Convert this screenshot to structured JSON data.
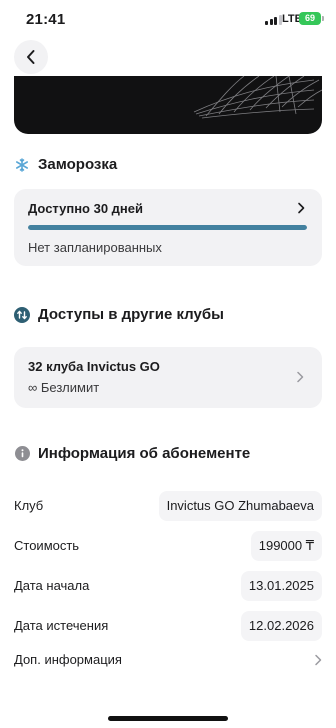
{
  "status_bar": {
    "time": "21:41",
    "network": "LTE",
    "battery": "69"
  },
  "freeze": {
    "title": "Заморозка",
    "available": "Доступно 30 дней",
    "progress": 1.0,
    "status": "Нет запланированных"
  },
  "clubs": {
    "title": "Доступы в другие клубы",
    "count_label": "32 клуба Invictus GO",
    "limit_label": "∞ Безлимит"
  },
  "membership": {
    "title": "Информация об абонементе",
    "rows": [
      {
        "label": "Клуб",
        "value": "Invictus GO Zhumabaeva"
      },
      {
        "label": "Стоимость",
        "value": "199000 ₸"
      },
      {
        "label": "Дата начала",
        "value": "13.01.2025"
      },
      {
        "label": "Дата истечения",
        "value": "12.02.2026"
      }
    ],
    "more_label": "Доп. информация"
  },
  "colors": {
    "accent": "#43819f",
    "panel": "#f2f2f4",
    "battery": "#35c759"
  },
  "icons": {
    "back": "chevron-left-icon",
    "freeze": "snowflake-icon",
    "clubs": "swap-arrows-icon",
    "info": "info-icon"
  }
}
